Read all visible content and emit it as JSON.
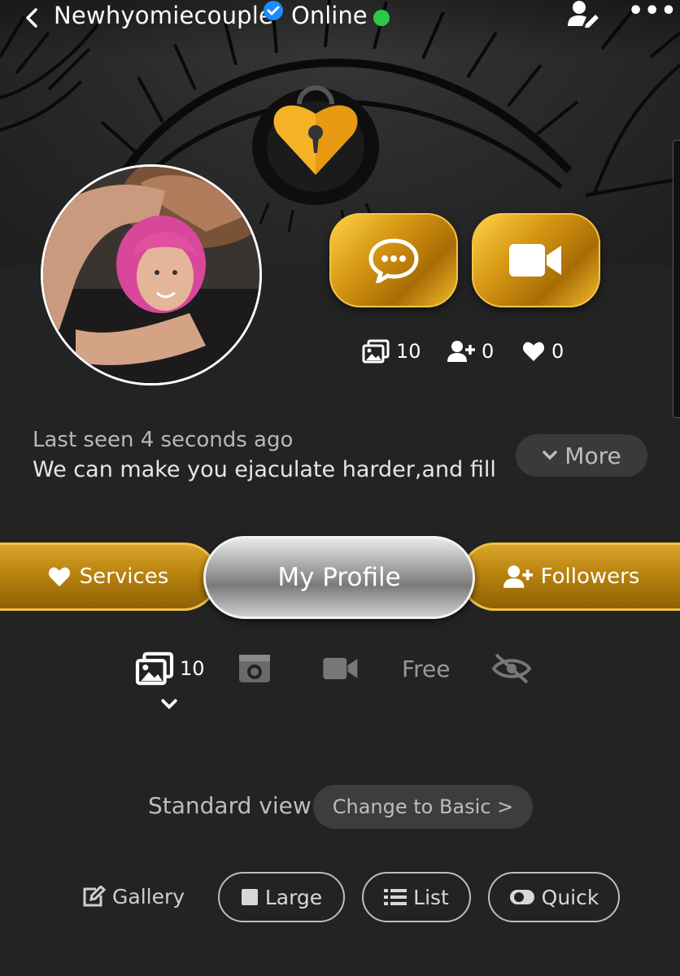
{
  "header": {
    "back_icon": "chevron-left-icon",
    "username": "Newhyomiecouple",
    "verified_icon": "verified-badge-icon",
    "status": "Online",
    "status_color": "#2ec94a",
    "edit_icon": "user-edit-icon",
    "menu": "•••"
  },
  "actions": {
    "chat_icon": "chat-bubble-icon",
    "video_icon": "video-camera-icon"
  },
  "stats": {
    "photos": "10",
    "followers": "0",
    "likes": "0"
  },
  "profile": {
    "last_seen": "Last seen 4 seconds ago",
    "bio": "We can make you ejaculate harder,and fill",
    "more_label": "More"
  },
  "tabs": {
    "services": "Services",
    "my_profile": "My Profile",
    "followers": "Followers"
  },
  "media_filters": {
    "photos_count": "10",
    "free_label": "Free"
  },
  "view": {
    "label": "Standard view",
    "change_button": "Change to Basic >"
  },
  "layout_buttons": {
    "gallery": "Gallery",
    "large": "Large",
    "list": "List",
    "quick": "Quick"
  },
  "colors": {
    "gold": "#d99a14",
    "background": "#232323"
  }
}
